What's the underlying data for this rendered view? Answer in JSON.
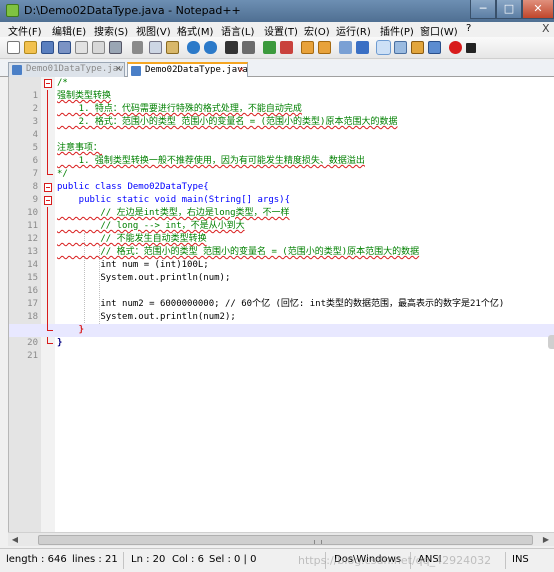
{
  "window": {
    "title": "D:\\Demo02DataType.java - Notepad++",
    "min_glyph": "─",
    "max_glyph": "□",
    "close_glyph": "✕"
  },
  "menu": [
    "文件(F)",
    "编辑(E)",
    "搜索(S)",
    "视图(V)",
    "格式(M)",
    "语言(L)",
    "设置(T)",
    "宏(O)",
    "运行(R)",
    "插件(P)",
    "窗口(W)",
    "?"
  ],
  "menu_close": "X",
  "tabs": [
    {
      "label": "Demo01DataType.java",
      "close": "✕"
    },
    {
      "label": "Demo02DataType.java",
      "close": "✕"
    }
  ],
  "code_lines": [
    "/*",
    "强制类型转换",
    "    1. 特点：代码需要进行特殊的格式处理，不能自动完成",
    "    2. 格式：范围小的类型 范围小的变量名 = (范围小的类型)原本范围大的数据",
    "",
    "注意事项：",
    "    1. 强制类型转换一般不推荐使用，因为有可能发生精度损失、数据溢出",
    "*/",
    "public class Demo02DataType{",
    "    public static void main(String[] args){",
    "        // 左边是int类型，右边是long类型，不一样",
    "        // long --> int，不是从小到大",
    "        // 不能发生自动类型转换",
    "        // 格式：范围小的类型 范围小的变量名 = (范围小的类型)原本范围大的数据",
    "        int num = (int)100L;",
    "        System.out.println(num);",
    "",
    "        int num2 = 6000000000; // 60个亿 (回忆: int类型的数据范围，最高表示的数字是21个亿)",
    "        System.out.println(num2);",
    "    }",
    "}"
  ],
  "status": {
    "length": "length : 646",
    "lines": "lines : 21",
    "ln": "Ln : 20",
    "col": "Col : 6",
    "sel": "Sel : 0 | 0",
    "eol": "Dos\\Windows",
    "encoding": "ANSI",
    "mode": "INS"
  },
  "watermark": "https://blog.csdn.net/qq_42924032"
}
